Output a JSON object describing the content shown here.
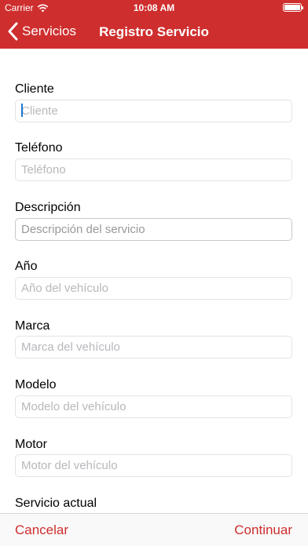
{
  "status_bar": {
    "carrier": "Carrier",
    "time": "10:08 AM"
  },
  "nav": {
    "back_label": "Servicios",
    "title": "Registro Servicio"
  },
  "form": {
    "fields": [
      {
        "label": "Cliente",
        "placeholder": "Cliente"
      },
      {
        "label": "Teléfono",
        "placeholder": "Teléfono"
      },
      {
        "label": "Descripción",
        "placeholder": "Descripción del servicio"
      },
      {
        "label": "Año",
        "placeholder": "Año del vehículo"
      },
      {
        "label": "Marca",
        "placeholder": "Marca del vehículo"
      },
      {
        "label": "Modelo",
        "placeholder": "Modelo del vehículo"
      },
      {
        "label": "Motor",
        "placeholder": "Motor del vehículo"
      },
      {
        "label": "Servicio actual"
      }
    ]
  },
  "toolbar": {
    "cancel_label": "Cancelar",
    "continue_label": "Continuar"
  },
  "colors": {
    "accent": "#cf2e2e",
    "toolbar_bg": "#f9f9f9",
    "cursor": "#1a78d6"
  }
}
